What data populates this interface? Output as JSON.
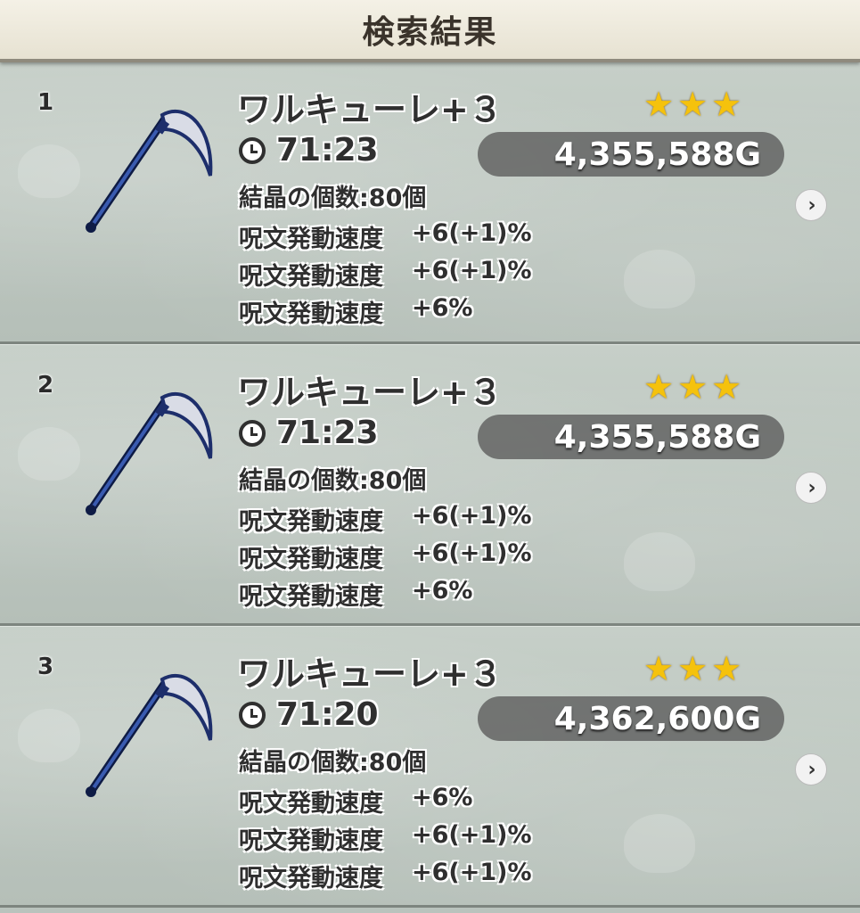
{
  "header": {
    "title": "検索結果"
  },
  "results": [
    {
      "rank": "1",
      "name": "ワルキューレ+３",
      "stars": 3,
      "time": "71:23",
      "price": "4,355,588G",
      "crystal": "結晶の個数:80個",
      "effects": [
        {
          "name": "呪文発動速度",
          "value": "+6(+1)%"
        },
        {
          "name": "呪文発動速度",
          "value": "+6(+1)%"
        },
        {
          "name": "呪文発動速度",
          "value": "+6%"
        }
      ]
    },
    {
      "rank": "2",
      "name": "ワルキューレ+３",
      "stars": 3,
      "time": "71:23",
      "price": "4,355,588G",
      "crystal": "結晶の個数:80個",
      "effects": [
        {
          "name": "呪文発動速度",
          "value": "+6(+1)%"
        },
        {
          "name": "呪文発動速度",
          "value": "+6(+1)%"
        },
        {
          "name": "呪文発動速度",
          "value": "+6%"
        }
      ]
    },
    {
      "rank": "3",
      "name": "ワルキューレ+３",
      "stars": 3,
      "time": "71:20",
      "price": "4,362,600G",
      "crystal": "結晶の個数:80個",
      "effects": [
        {
          "name": "呪文発動速度",
          "value": "+6%"
        },
        {
          "name": "呪文発動速度",
          "value": "+6(+1)%"
        },
        {
          "name": "呪文発動速度",
          "value": "+6(+1)%"
        }
      ]
    }
  ],
  "icons": {
    "weapon": "scythe-icon",
    "time": "clock-icon",
    "detail": "chevron-right-icon",
    "rarity": "star-icon"
  },
  "colors": {
    "star": "#f5c20c",
    "price_bg": "#5a5a5a",
    "weapon_blue": "#1d2e6b"
  }
}
